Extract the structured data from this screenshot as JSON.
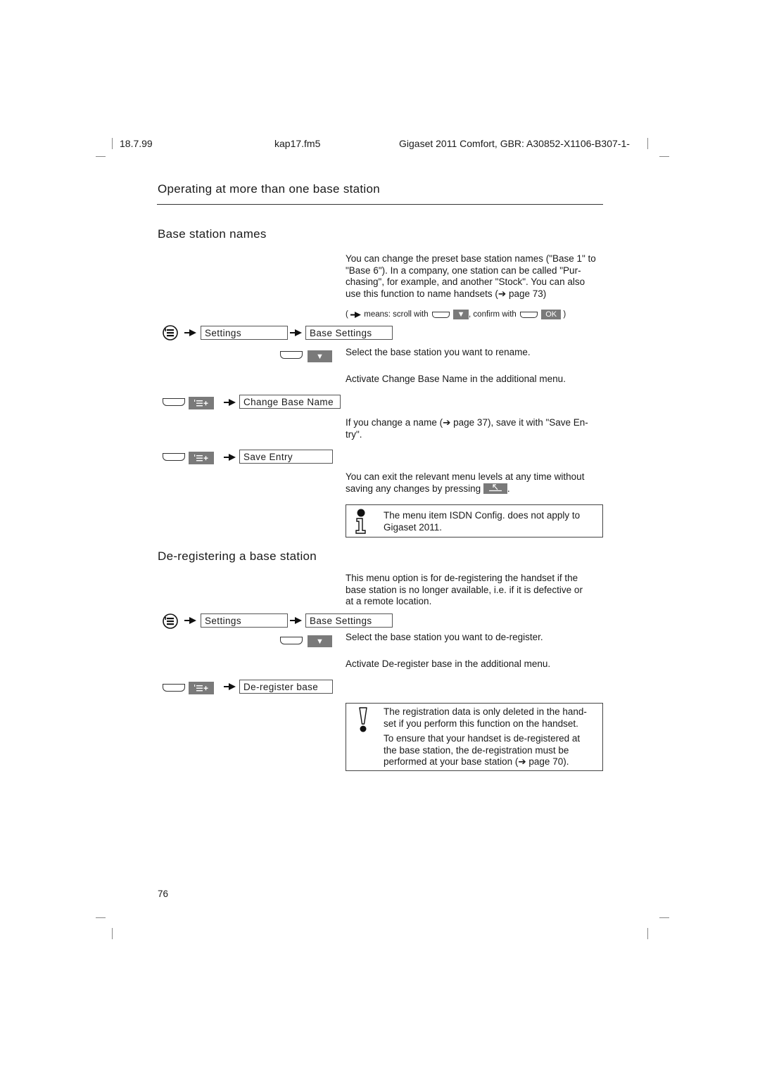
{
  "header": {
    "date": "18.7.99",
    "file": "kap17.fm5",
    "product": "Gigaset 2011 Comfort, GBR: A30852-X1106-B307-1-"
  },
  "chapter_title": "Operating at more than one base station",
  "section1": {
    "title": "Base station names",
    "intro": "You can change the preset base station names (\"Base 1\" to \"Base 6\"). In a company, one station can be called \"Pur-chasing\", for example, and another \"Stock\". You can also use this function to name handsets (➔ page 73)",
    "intro_lines": [
      "You can change the preset base station names (\"Base 1\" to",
      "\"Base 6\"). In a company, one station can be called \"Pur-",
      "chasing\", for example, and another \"Stock\". You can also",
      "use this function to name handsets (➔ page 73)"
    ],
    "legend": {
      "open": "(",
      "means": "means: scroll with",
      "comma": ", confirm with",
      "ok_key": "OK",
      "close": ")"
    },
    "menu_path": [
      "Settings",
      "Base Settings"
    ],
    "step_select": "Select the base station you want to rename.",
    "step_activate": "Activate Change Base Name in the additional menu.",
    "menu_change": "Change Base Name",
    "step_change_lines": [
      "If you change a name (➔ page 37), save it with \"Save En-",
      "try\"."
    ],
    "menu_save": "Save Entry",
    "exit_lines": [
      "You can exit the relevant menu levels at any time without",
      "saving any changes by pressing"
    ],
    "exit_suffix": ".",
    "note_lines": [
      "The menu item ISDN Config. does not apply to",
      "Gigaset 2011."
    ]
  },
  "section2": {
    "title": "De-registering a base station",
    "intro_lines": [
      "This menu option is for de-registering the handset if the",
      "base station is no longer available, i.e. if it is defective or",
      "at a remote location."
    ],
    "menu_path": [
      "Settings",
      "Base Settings"
    ],
    "step_select": "Select the base station you want to de-register.",
    "step_activate": "Activate De-register base in the additional menu.",
    "menu_deregister": "De-register base",
    "warning_p1": [
      "The registration data is only deleted in the hand-",
      "set if you perform this function on the handset."
    ],
    "warning_p2": [
      "To ensure that your handset is de-registered at",
      "the base station, the de-registration must be",
      "performed at your base station (➔ page 70)."
    ]
  },
  "page_number": "76",
  "colors": {
    "key_gray": "#7a7a7a",
    "text": "#1a1a1a",
    "rule": "#333333"
  }
}
